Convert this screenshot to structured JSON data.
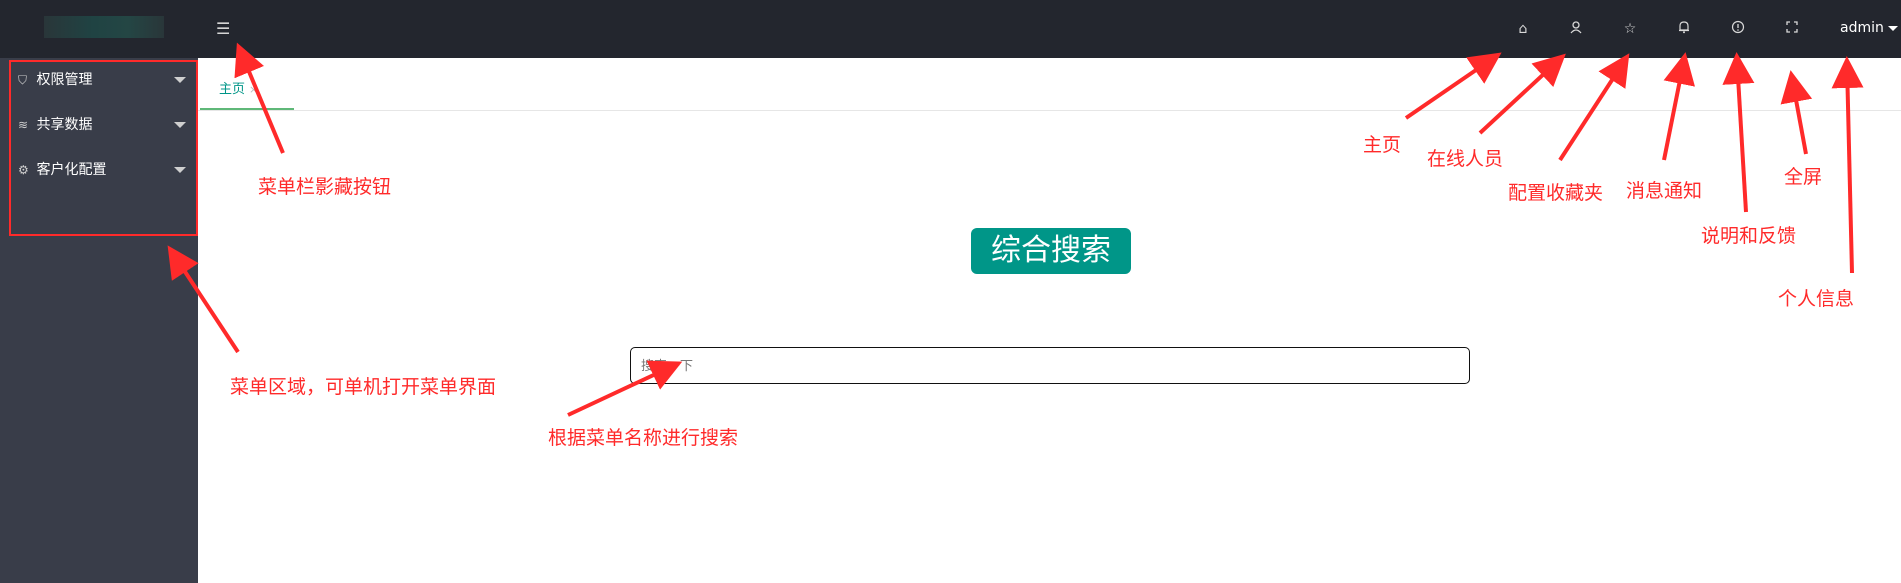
{
  "header": {
    "admin_label": "admin",
    "icons": [
      "home-icon",
      "user-icon",
      "star-icon",
      "bell-icon",
      "info-icon",
      "fullscreen-icon"
    ]
  },
  "sidebar": {
    "items": [
      {
        "label": "权限管理",
        "icon": "shield-check-icon"
      },
      {
        "label": "共享数据",
        "icon": "layers-icon"
      },
      {
        "label": "客户化配置",
        "icon": "gear-icon"
      }
    ]
  },
  "tabs": [
    {
      "label": "主页"
    }
  ],
  "main": {
    "title": "综合搜索",
    "search_placeholder": "搜索一下"
  },
  "annotations": {
    "menu_toggle": "菜单栏影藏按钮",
    "menu_area": "菜单区域，可单机打开菜单界面",
    "search_hint": "根据菜单名称进行搜索",
    "home": "主页",
    "online_users": "在线人员",
    "config_favorites": "配置收藏夹",
    "notifications": "消息通知",
    "about_feedback": "说明和反馈",
    "fullscreen": "全屏",
    "profile": "个人信息"
  },
  "colors": {
    "topbar": "#23262e",
    "sidebar": "#393d49",
    "accent": "#009688",
    "annotation": "#ff2a2a"
  }
}
